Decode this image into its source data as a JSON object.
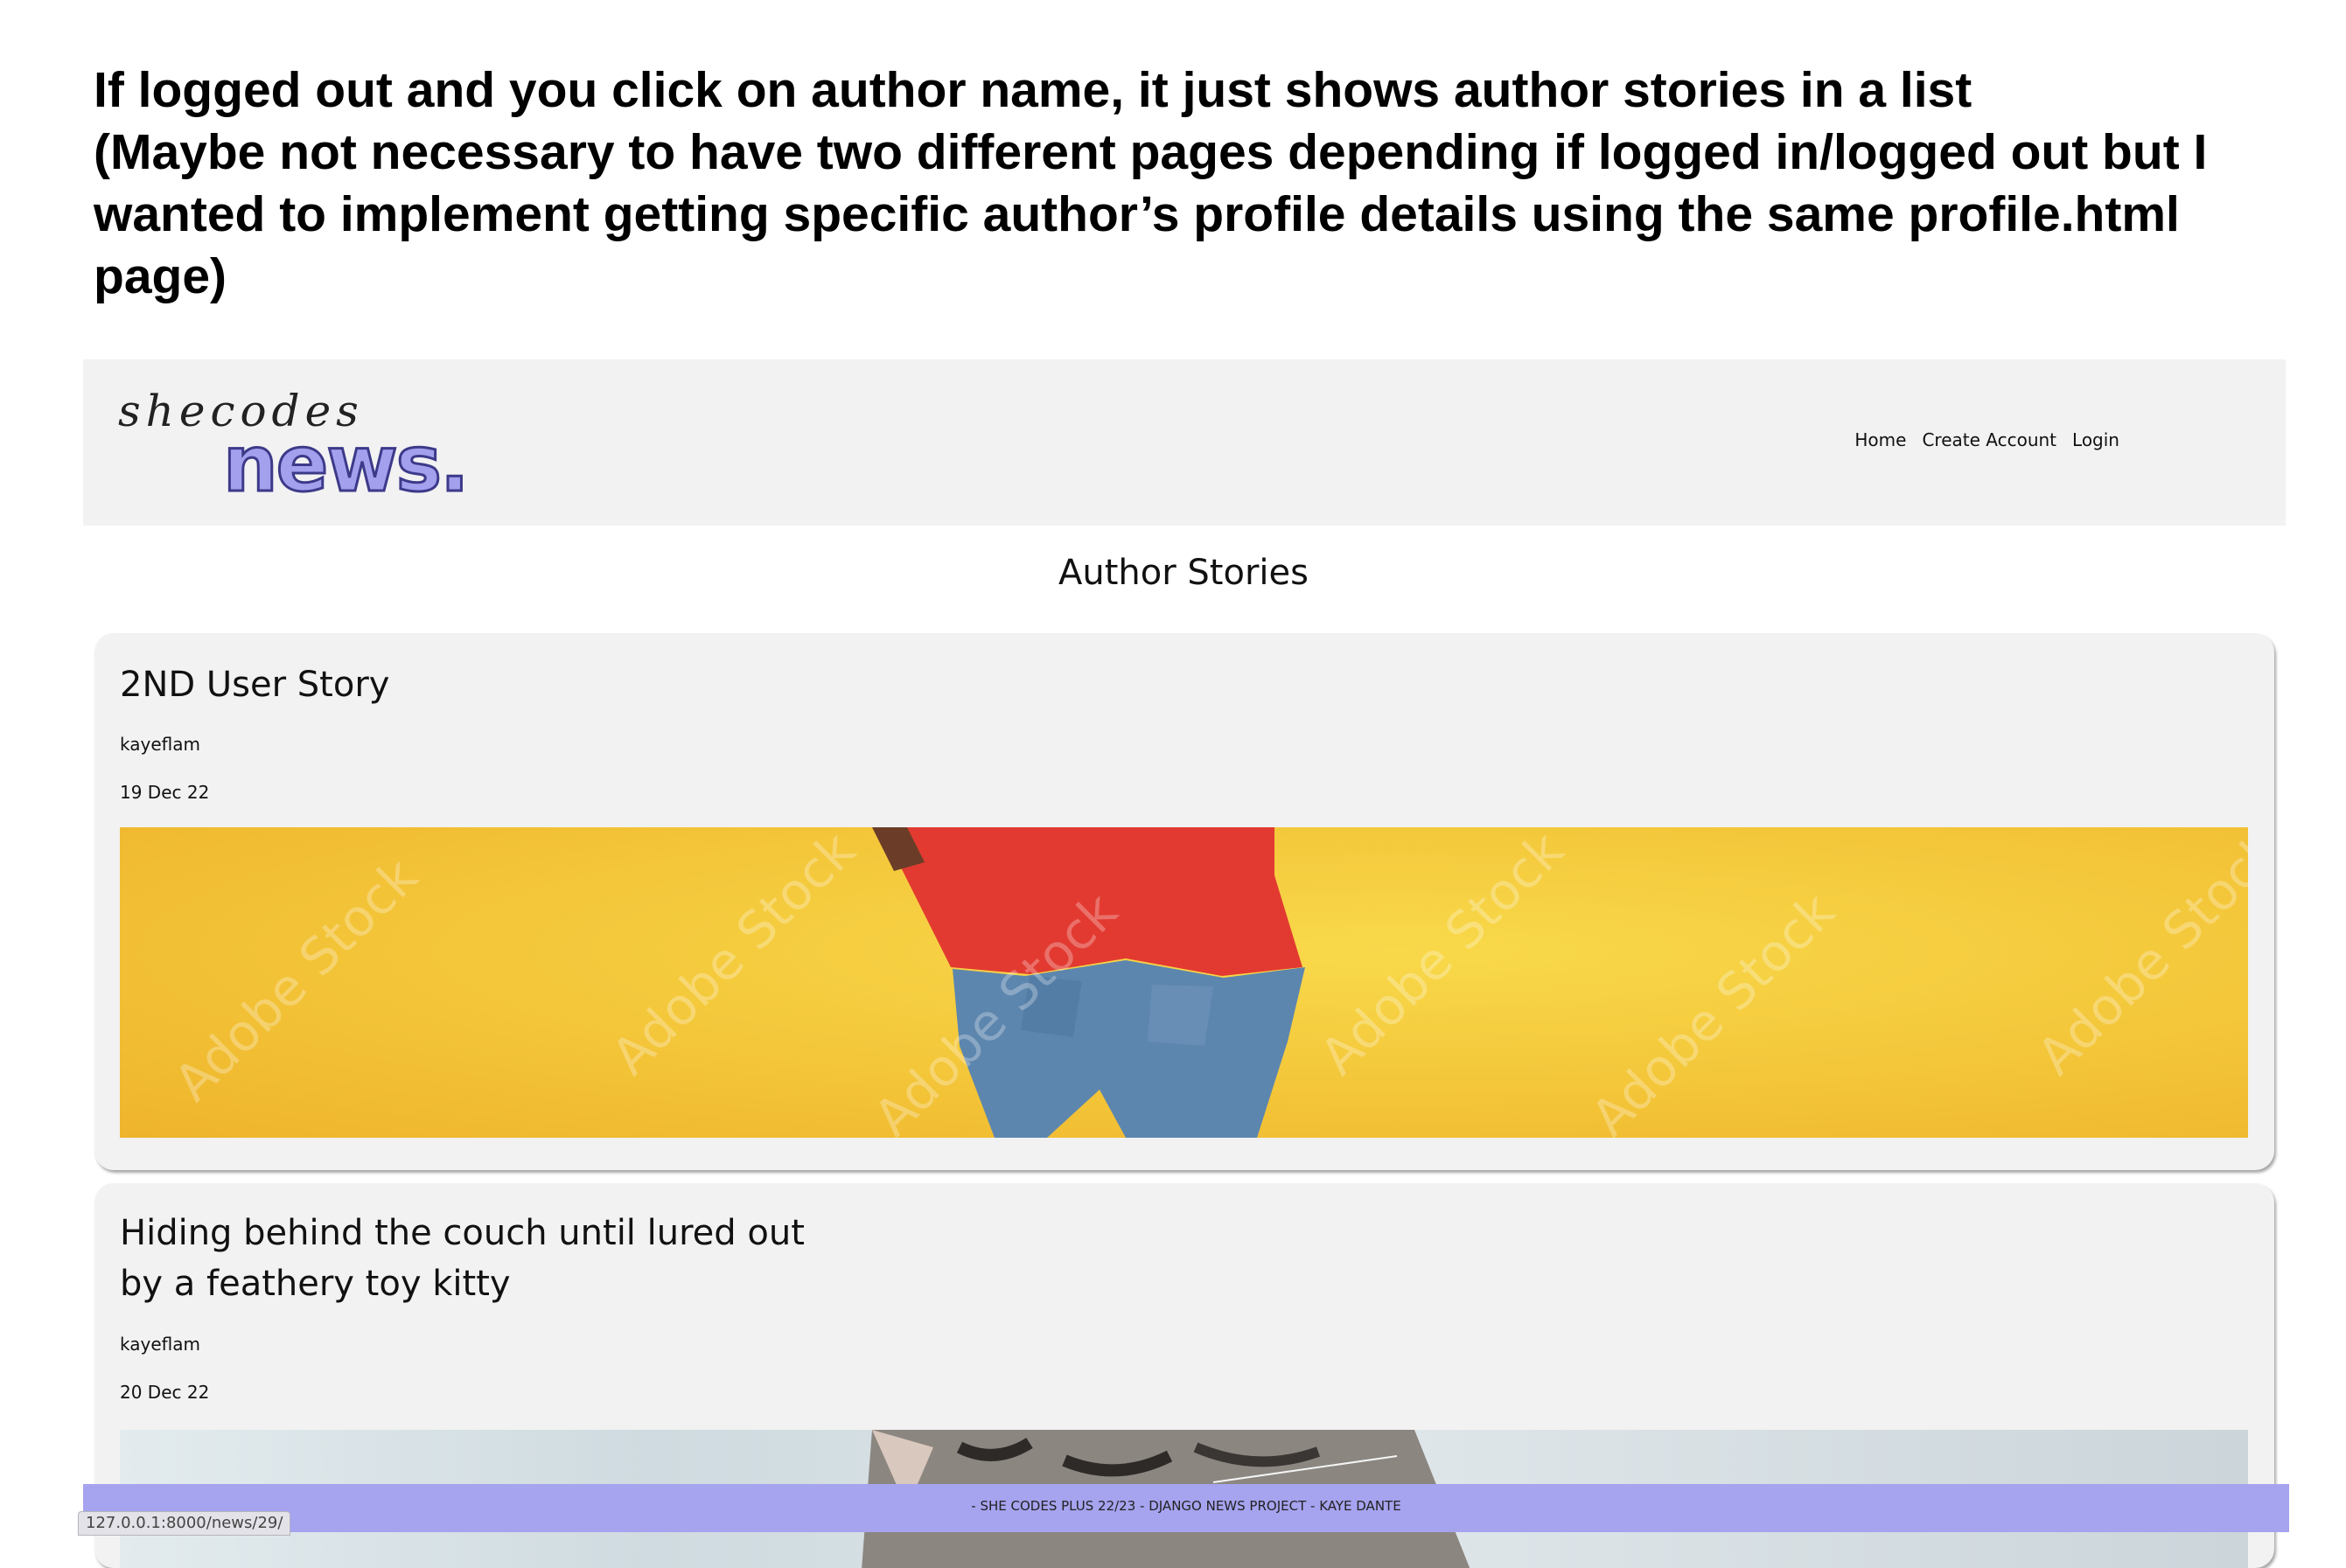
{
  "annotation": {
    "line1": "If logged out and you click on author name, it just shows author stories in a list",
    "line2": "(Maybe not necessary to have two different pages depending if logged in/logged out but I",
    "line3": "wanted to implement getting specific author’s profile details using the same profile.html",
    "line4": "page)"
  },
  "header": {
    "logo_script": "shecodes",
    "logo_word": "news.",
    "nav": [
      "Home",
      "Create Account",
      "Login"
    ]
  },
  "page": {
    "heading": "Author Stories"
  },
  "stories": [
    {
      "title": "2ND User Story",
      "author": "kayeflam",
      "date": "19 Dec 22"
    },
    {
      "title": "Hiding behind the couch until lured out\nby a feathery toy kitty",
      "author": "kayeflam",
      "date": "20 Dec 22"
    }
  ],
  "image_watermark": "Adobe Stock",
  "footer": {
    "text": "- SHE CODES PLUS 22/23 - DJANGO NEWS PROJECT - KAYE DANTE"
  },
  "status_bar": {
    "url": "127.0.0.1:8000/news/29/"
  },
  "colors": {
    "accent": "#a6a3ef",
    "header_bg": "#f2f2f2",
    "image_yellow": "#f3c337"
  }
}
